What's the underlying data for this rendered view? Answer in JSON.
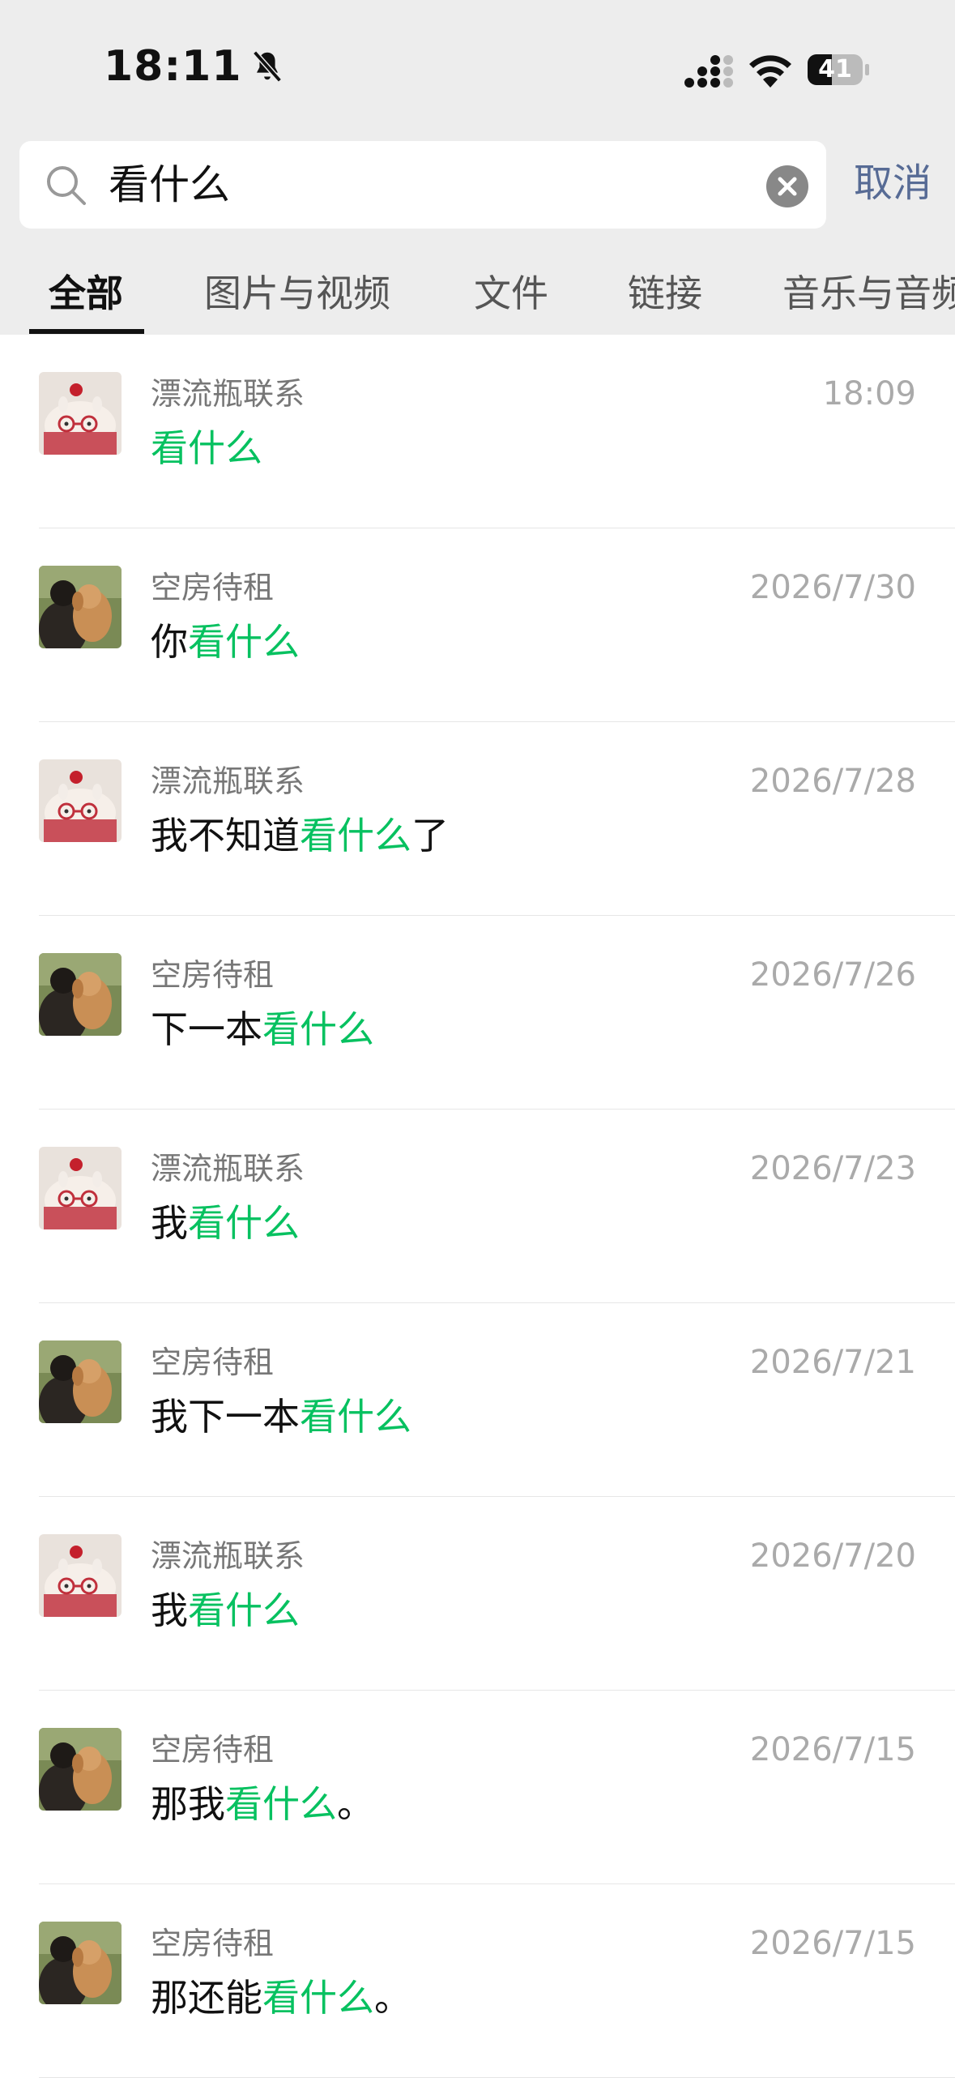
{
  "status_bar": {
    "time": "18:11",
    "battery": "41",
    "icons": [
      "bell-slash-icon",
      "signal-icon",
      "wifi-icon",
      "battery-icon"
    ]
  },
  "search": {
    "query": "看什么",
    "cancel_label": "取消"
  },
  "tabs": [
    {
      "label": "全部",
      "active": true
    },
    {
      "label": "图片与视频",
      "active": false
    },
    {
      "label": "文件",
      "active": false
    },
    {
      "label": "链接",
      "active": false
    },
    {
      "label": "音乐与音频",
      "active": false
    }
  ],
  "colors": {
    "highlight": "#07c160",
    "link": "#576b95",
    "header_bg": "#ededed"
  },
  "results": [
    {
      "name": "漂流瓶联系",
      "date": "18:09",
      "before": "",
      "match": "看什么",
      "after": "",
      "avatar": "cake"
    },
    {
      "name": "空房待租",
      "date": "2026/7/30",
      "before": "你",
      "match": "看什么",
      "after": "",
      "avatar": "dog"
    },
    {
      "name": "漂流瓶联系",
      "date": "2026/7/28",
      "before": "我不知道",
      "match": "看什么",
      "after": "了",
      "avatar": "cake"
    },
    {
      "name": "空房待租",
      "date": "2026/7/26",
      "before": "下一本",
      "match": "看什么",
      "after": "",
      "avatar": "dog"
    },
    {
      "name": "漂流瓶联系",
      "date": "2026/7/23",
      "before": "我",
      "match": "看什么",
      "after": "",
      "avatar": "cake"
    },
    {
      "name": "空房待租",
      "date": "2026/7/21",
      "before": "我下一本",
      "match": "看什么",
      "after": "",
      "avatar": "dog"
    },
    {
      "name": "漂流瓶联系",
      "date": "2026/7/20",
      "before": "我",
      "match": "看什么",
      "after": "",
      "avatar": "cake"
    },
    {
      "name": "空房待租",
      "date": "2026/7/15",
      "before": "那我",
      "match": "看什么",
      "after": "。",
      "avatar": "dog"
    },
    {
      "name": "空房待租",
      "date": "2026/7/15",
      "before": "那还能",
      "match": "看什么",
      "after": "。",
      "avatar": "dog"
    }
  ]
}
